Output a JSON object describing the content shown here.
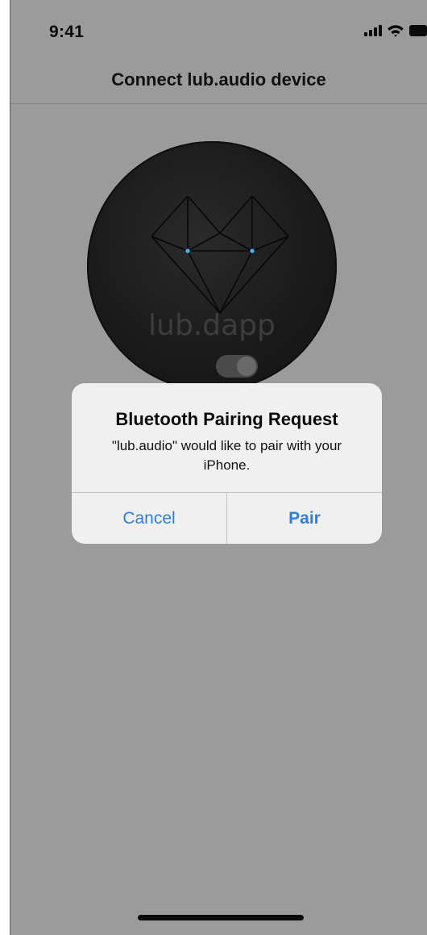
{
  "status_bar": {
    "time": "9:41",
    "icons": [
      "cellular-signal-icon",
      "wifi-icon",
      "battery-icon"
    ]
  },
  "nav": {
    "title": "Connect lub.audio device"
  },
  "device": {
    "brand_text": "lub.dapp",
    "icon": "heart-diamond-logo-icon"
  },
  "alert": {
    "title": "Bluetooth Pairing Request",
    "message": "\"lub.audio\" would like to pair with your iPhone.",
    "cancel_label": "Cancel",
    "pair_label": "Pair"
  },
  "colors": {
    "background_dimmed": "#9b9b9b",
    "alert_background": "#f0f0f0",
    "button_blue": "#2f7ed8",
    "device_body": "#1b1b1b",
    "led_blue": "#3fb8ff"
  }
}
